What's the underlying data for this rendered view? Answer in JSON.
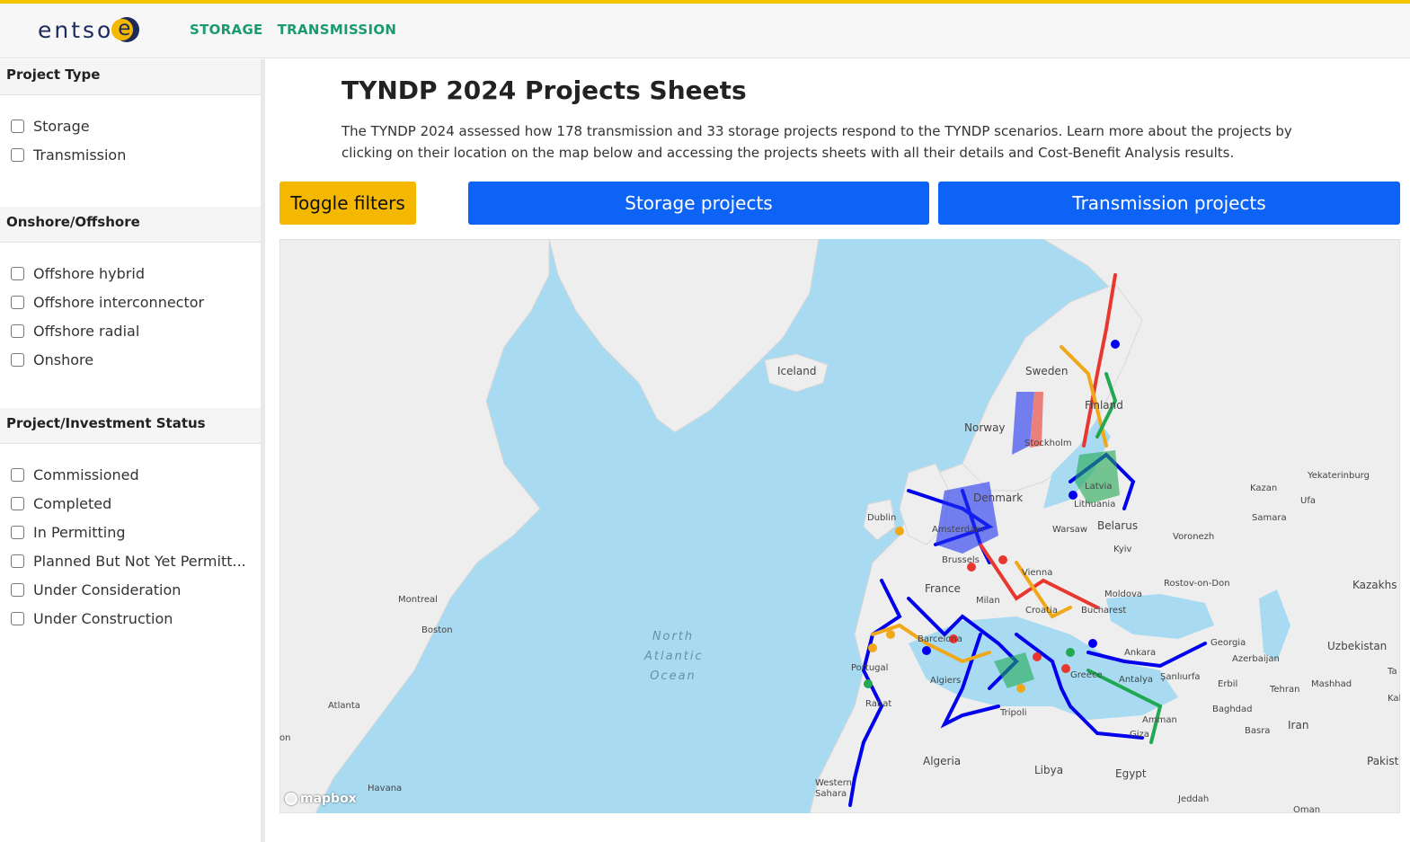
{
  "header": {
    "logo_text": "entso",
    "logo_e": "e",
    "nav": [
      "STORAGE",
      "TRANSMISSION"
    ]
  },
  "sidebar": {
    "sections": [
      {
        "title": "Project Type",
        "options": [
          "Storage",
          "Transmission"
        ]
      },
      {
        "title": "Onshore/Offshore",
        "options": [
          "Offshore hybrid",
          "Offshore interconnector",
          "Offshore radial",
          "Onshore"
        ]
      },
      {
        "title": "Project/Investment Status",
        "options": [
          "Commissioned",
          "Completed",
          "In Permitting",
          "Planned But Not Yet Permitt...",
          "Under Consideration",
          "Under Construction"
        ]
      }
    ]
  },
  "main": {
    "title": "TYNDP 2024 Projects Sheets",
    "intro": "The TYNDP 2024 assessed how 178 transmission and 33 storage projects respond to the TYNDP scenarios. Learn more about the projects by clicking on their location on the map below and accessing the projects sheets with all their details and Cost-Benefit Analysis results.",
    "buttons": {
      "toggle": "Toggle filters",
      "storage": "Storage projects",
      "transmission": "Transmission projects"
    }
  },
  "map": {
    "attribution": "mapbox",
    "ocean_label": [
      "North",
      "Atlantic",
      "Ocean"
    ],
    "labels": [
      "Iceland",
      "Sweden",
      "Finland",
      "Norway",
      "Stockholm",
      "Latvia",
      "Lithuania",
      "Denmark",
      "Dublin",
      "Amsterdam",
      "Brussels",
      "Warsaw",
      "Belarus",
      "Kyiv",
      "France",
      "Vienna",
      "Milan",
      "Moldova",
      "Croatia",
      "Bucharest",
      "Barcelona",
      "Portugal",
      "Algiers",
      "Rabat",
      "Tripoli",
      "Algeria",
      "Libya",
      "Egypt",
      "Greece",
      "Antalya",
      "Ankara",
      "Amman",
      "Giza",
      "Baghdad",
      "Basra",
      "Iran",
      "Tehran",
      "Mashhad",
      "Uzbekistan",
      "Azerbaijan",
      "Erbil",
      "Georgia",
      "Şanlıurfa",
      "Rostov-on-Don",
      "Voronezh",
      "Samara",
      "Kazan",
      "Ufa",
      "Yekaterinburg",
      "Kazakhs",
      "Montreal",
      "Boston",
      "Atlanta",
      "Havana",
      "Western Sahara",
      "Jeddah",
      "Pakist",
      "Oman",
      "Ta",
      "Kal",
      "on"
    ],
    "colors": {
      "offshore_hybrid": "#0000ee",
      "onshore_planned": "#e8372f",
      "storage": "#f0a818",
      "completed": "#22a852",
      "offshore_radial": "#d9a441"
    }
  }
}
